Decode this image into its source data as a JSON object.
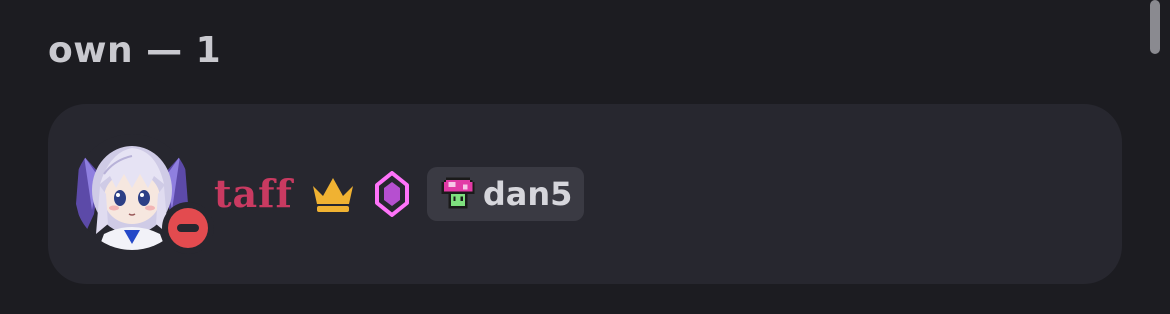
{
  "section": {
    "title": "own — 1"
  },
  "member": {
    "username": "taff",
    "tag": "dan5",
    "status": "do-not-disturb",
    "avatar_icon": "anime-avatar",
    "badges": [
      "crown-icon",
      "nitro-boost-icon"
    ],
    "tag_icon": "mushroom-icon"
  },
  "colors": {
    "background": "#1c1c21",
    "card": "#27272f",
    "username": "#c93a61",
    "crown": "#f0b232",
    "boost": "#ff73fa",
    "dnd": "#e34b4f",
    "tag_bg": "#3a3a43"
  }
}
